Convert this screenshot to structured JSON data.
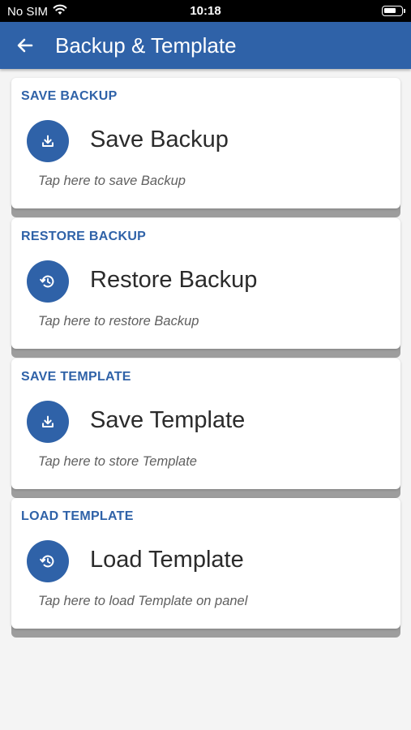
{
  "status_bar": {
    "carrier": "No SIM",
    "time": "10:18",
    "wifi_icon": "wifi-icon",
    "battery_icon": "battery-icon"
  },
  "header": {
    "title": "Backup & Template",
    "back_icon": "arrow-left-icon",
    "color": "#2f62a8"
  },
  "cards": [
    {
      "label": "SAVE BACKUP",
      "title": "Save Backup",
      "hint": "Tap here to save Backup",
      "icon": "download-icon"
    },
    {
      "label": "RESTORE BACKUP",
      "title": "Restore Backup",
      "hint": "Tap here to restore Backup",
      "icon": "history-icon"
    },
    {
      "label": "SAVE TEMPLATE",
      "title": "Save Template",
      "hint": "Tap here to store Template",
      "icon": "download-icon"
    },
    {
      "label": "LOAD TEMPLATE",
      "title": "Load Template",
      "hint": "Tap here to load Template on panel",
      "icon": "history-icon"
    }
  ]
}
